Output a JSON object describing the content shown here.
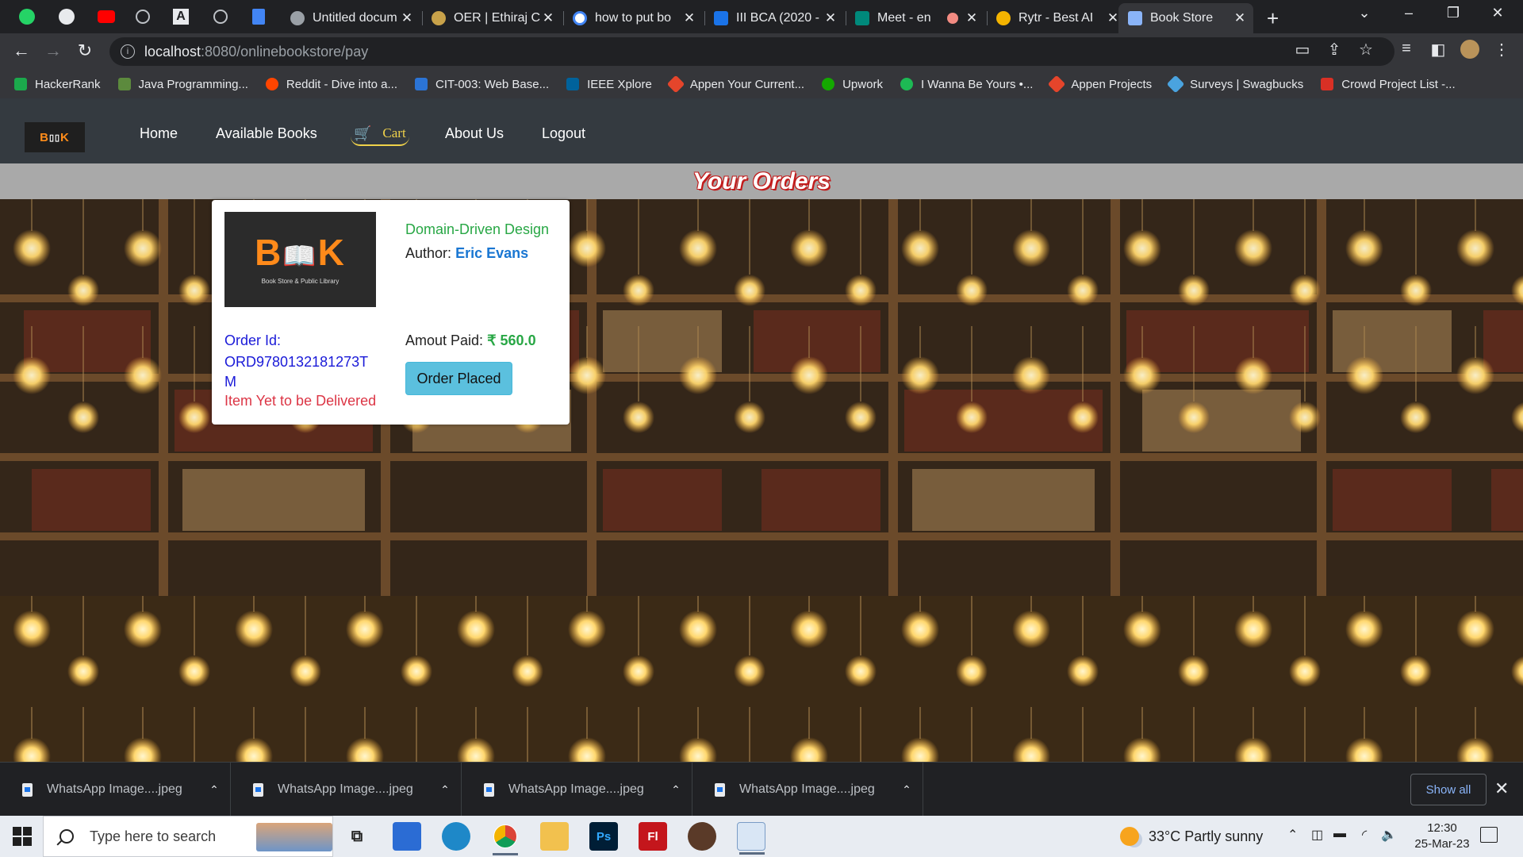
{
  "browser": {
    "tabs": [
      {
        "title": "Untitled docum",
        "color": "#9aa0a6"
      },
      {
        "title": "OER | Ethiraj C",
        "color": "#c8a24a"
      },
      {
        "title": "how to put bo",
        "color": "#4285f4"
      },
      {
        "title": "III BCA (2020 -",
        "color": "#1a73e8"
      },
      {
        "title": "Meet - en",
        "color": "#00897b"
      },
      {
        "title": "Rytr - Best AI",
        "color": "#f4b400"
      },
      {
        "title": "Book Store",
        "color": "#8ab4f8"
      }
    ],
    "tab_close_glyph": "✕",
    "new_tab_glyph": "+",
    "url_host": "localhost",
    "url_path": ":8080/onlinebookstore/pay"
  },
  "bookmarks": [
    {
      "label": "HackerRank",
      "color": "#1ba94c"
    },
    {
      "label": "Java Programming...",
      "color": "#5c8a3d"
    },
    {
      "label": "Reddit - Dive into a...",
      "color": "#ff4500"
    },
    {
      "label": "CIT-003: Web Base...",
      "color": "#2b74d6"
    },
    {
      "label": "IEEE Xplore",
      "color": "#00629b"
    },
    {
      "label": "Appen Your Current...",
      "color": "#e5452b"
    },
    {
      "label": "Upwork",
      "color": "#14a800"
    },
    {
      "label": "I Wanna Be Yours •...",
      "color": "#1db954"
    },
    {
      "label": "Appen Projects",
      "color": "#e5452b"
    },
    {
      "label": "Surveys | Swagbucks",
      "color": "#4aa3df"
    },
    {
      "label": "Crowd Project List -...",
      "color": "#d93025"
    }
  ],
  "site": {
    "brand_prefix": "B",
    "brand_mid": "▯▯",
    "brand_suffix": "K",
    "nav": [
      "Home",
      "Available Books",
      "About Us",
      "Logout"
    ],
    "cart_label": "Cart",
    "orders_title": "Your Orders"
  },
  "order": {
    "cover_logo_prefix": "B",
    "cover_logo_mid": "📖",
    "cover_logo_suffix": "K",
    "cover_subtitle": "Book Store & Public Library",
    "book_title": "Domain-Driven Design",
    "author_label": "Author:",
    "author_name": "Eric Evans",
    "order_id_label": "Order Id:",
    "order_id": "ORD9780132181273TM",
    "delivery_status": "Item Yet to be Delivered",
    "amount_label": "Amout Paid:",
    "amount": "₹ 560.0",
    "status_button": "Order Placed"
  },
  "downloads": {
    "items": [
      "WhatsApp Image....jpeg",
      "WhatsApp Image....jpeg",
      "WhatsApp Image....jpeg",
      "WhatsApp Image....jpeg"
    ],
    "show_all": "Show all"
  },
  "taskbar": {
    "search_placeholder": "Type here to search",
    "weather": "33°C  Partly sunny",
    "time": "12:30",
    "date": "25-Mar-23"
  },
  "colors": {
    "navbar": "#343a40",
    "accent_cart": "#f0d24a",
    "title_red": "#c21b1b",
    "button_info": "#5bc0de"
  }
}
